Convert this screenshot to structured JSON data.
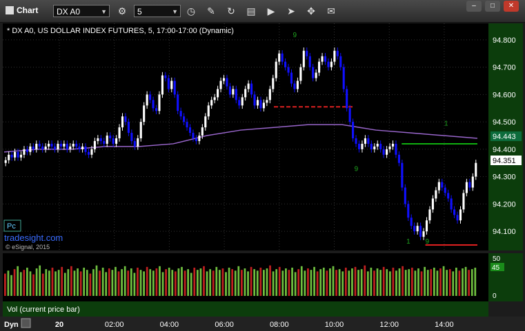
{
  "toolbar": {
    "title": "Chart",
    "symbol": "DX A0",
    "interval": "5",
    "window_buttons": [
      "–",
      "□",
      "✕"
    ]
  },
  "chart": {
    "header": "* DX A0, US DOLLAR INDEX FUTURES, 5, 17:00-17:00 (Dynamic)",
    "pc_label": "Pc",
    "watermark": "tradesight.com",
    "copyright": "© eSignal, 2015",
    "current_price_label": "94.351",
    "ma_price_label": "94.443",
    "volume_label": "Vol (current price bar)",
    "volume_value_label": "45",
    "dyn_label": "Dyn"
  },
  "colors": {
    "up": "#ffffff",
    "down": "#1010ff",
    "background": "#000000",
    "axis_bg": "#0c3d0c",
    "ma_line": "#9966cc",
    "setup_digits": "#1fa51f",
    "resistance": "#e02020",
    "support_green": "#10b010"
  },
  "chart_data": {
    "type": "candlestick",
    "price_axis": {
      "ticks": [
        "94.800",
        "94.700",
        "94.600",
        "94.500",
        "94.400",
        "94.300",
        "94.200",
        "94.100"
      ],
      "ylim": [
        94.03,
        94.86
      ]
    },
    "time_axis": {
      "ticks": [
        "20",
        "02:00",
        "04:00",
        "06:00",
        "08:00",
        "10:00",
        "12:00",
        "14:00"
      ]
    },
    "volume_axis": {
      "ticks": [
        "50",
        "0"
      ]
    },
    "ohlc_close": [
      94.36,
      94.38,
      94.37,
      94.39,
      94.37,
      94.38,
      94.4,
      94.39,
      94.41,
      94.4,
      94.42,
      94.41,
      94.4,
      94.41,
      94.42,
      94.41,
      94.4,
      94.42,
      94.41,
      94.42,
      94.4,
      94.41,
      94.42,
      94.41,
      94.4,
      94.41,
      94.39,
      94.38,
      94.4,
      94.43,
      94.44,
      94.43,
      94.42,
      94.45,
      94.44,
      94.42,
      94.44,
      94.48,
      94.52,
      94.5,
      94.46,
      94.43,
      94.41,
      94.44,
      94.5,
      94.56,
      94.6,
      94.58,
      94.55,
      94.54,
      94.6,
      94.67,
      94.66,
      94.62,
      94.65,
      94.6,
      94.54,
      94.52,
      94.5,
      94.48,
      94.46,
      94.44,
      94.43,
      94.45,
      94.48,
      94.52,
      94.56,
      94.58,
      94.59,
      94.62,
      94.65,
      94.66,
      94.63,
      94.6,
      94.62,
      94.58,
      94.56,
      94.59,
      94.62,
      94.64,
      94.6,
      94.56,
      94.58,
      94.55,
      94.57,
      94.58,
      94.62,
      94.66,
      94.72,
      94.75,
      94.72,
      94.7,
      94.68,
      94.64,
      94.62,
      94.65,
      94.7,
      94.76,
      94.74,
      94.7,
      94.66,
      94.68,
      94.72,
      94.74,
      94.72,
      94.7,
      94.72,
      94.76,
      94.74,
      94.7,
      94.62,
      94.55,
      94.5,
      94.44,
      94.42,
      94.4,
      94.42,
      94.44,
      94.42,
      94.4,
      94.41,
      94.42,
      94.4,
      94.38,
      94.4,
      94.41,
      94.42,
      94.38,
      94.35,
      94.26,
      94.2,
      94.15,
      94.12,
      94.1,
      94.12,
      94.08,
      94.1,
      94.14,
      94.18,
      94.22,
      94.25,
      94.28,
      94.26,
      94.24,
      94.22,
      94.18,
      94.16,
      94.14,
      94.18,
      94.24,
      94.28,
      94.26,
      94.3,
      94.35
    ],
    "moving_average": [
      94.39,
      94.4,
      94.4,
      94.41,
      94.41,
      94.42,
      94.45,
      94.47,
      94.48,
      94.49,
      94.49,
      94.47,
      94.46,
      94.45,
      94.44
    ],
    "moving_average_name": "",
    "volume_values": [
      30,
      34,
      28,
      36,
      40,
      32,
      35,
      38,
      33,
      29,
      37,
      41,
      30,
      36,
      34,
      38,
      33,
      35,
      39,
      31,
      36,
      40,
      34,
      37,
      33,
      38,
      35,
      30,
      36,
      41,
      34,
      38,
      32,
      37,
      35,
      39,
      33,
      36,
      40,
      34,
      37,
      31,
      38,
      35,
      33,
      39,
      36,
      34,
      37,
      40,
      32,
      36,
      38,
      35,
      33,
      37,
      39,
      34,
      36,
      31,
      38,
      35,
      37,
      40,
      33,
      36,
      34,
      39,
      35,
      37,
      32,
      38,
      36,
      34,
      40,
      35,
      37,
      33,
      39,
      36,
      34,
      38,
      35,
      37,
      41,
      33,
      36,
      39,
      34,
      37,
      35,
      38,
      32,
      36,
      40,
      34,
      37,
      35,
      39,
      33,
      36,
      38,
      34,
      37,
      40,
      35,
      36,
      33,
      38,
      34,
      37,
      39,
      35,
      36,
      41,
      33,
      38,
      34,
      37,
      35,
      39,
      36,
      33,
      38,
      34,
      37,
      40,
      35,
      36,
      38,
      34,
      37,
      33,
      39,
      35,
      36,
      38,
      34,
      37,
      40,
      35,
      36,
      33,
      38,
      34,
      37,
      39,
      35,
      36,
      38
    ],
    "levels": [
      {
        "name": "resistance-dashed",
        "price": 94.555,
        "color": "#e02020"
      },
      {
        "name": "green-level",
        "price": 94.42,
        "color": "#10b010"
      },
      {
        "name": "low-level",
        "price": 94.05,
        "color": "#e02020"
      }
    ],
    "setup_digit_labels": [
      "9",
      "1",
      "9",
      "9",
      "1"
    ]
  }
}
